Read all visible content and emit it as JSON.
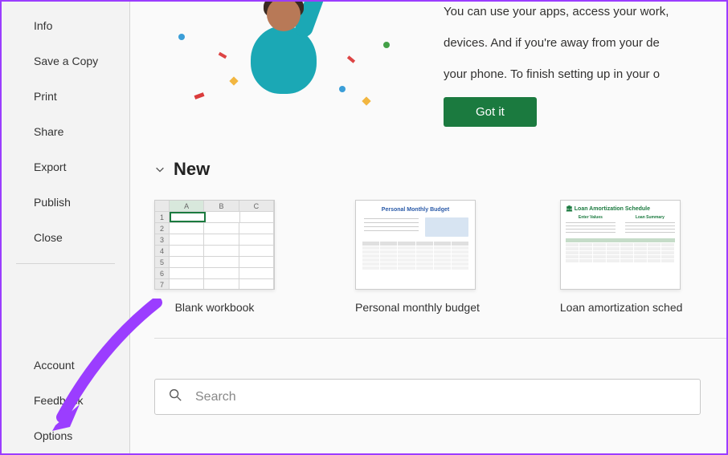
{
  "sidebar": {
    "primary": [
      {
        "label": "Info"
      },
      {
        "label": "Save a Copy"
      },
      {
        "label": "Print"
      },
      {
        "label": "Share"
      },
      {
        "label": "Export"
      },
      {
        "label": "Publish"
      },
      {
        "label": "Close"
      }
    ],
    "secondary": [
      {
        "label": "Account"
      },
      {
        "label": "Feedback"
      },
      {
        "label": "Options"
      }
    ]
  },
  "banner": {
    "line1": "You can use your apps, access your work,",
    "line2": "devices. And if you're away from your de",
    "line3": "your phone. To finish setting up in your o",
    "button": "Got it"
  },
  "sections": {
    "new": {
      "title": "New",
      "templates": [
        {
          "label": "Blank workbook"
        },
        {
          "label": "Personal monthly budget",
          "thumb_title": "Personal Monthly Budget"
        },
        {
          "label": "Loan amortization sched",
          "thumb_title": "Loan Amortization Schedule",
          "thumb_col1": "Enter Values",
          "thumb_col2": "Loan Summary"
        }
      ]
    }
  },
  "search": {
    "placeholder": "Search"
  },
  "colors": {
    "accent": "#1b7a3f",
    "annotation": "#9b3dff"
  }
}
